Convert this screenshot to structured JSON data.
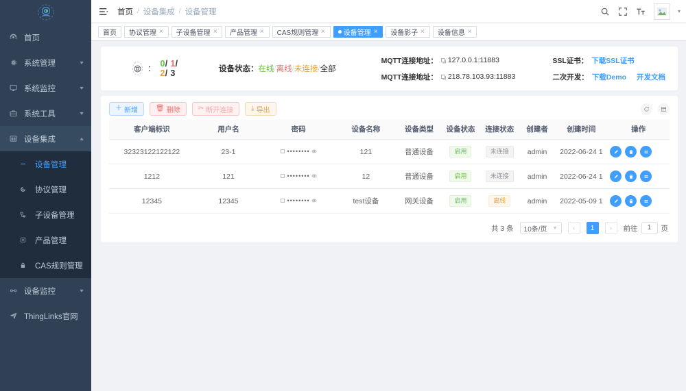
{
  "sidebar": {
    "logo_icon": "fingerprint-logo-icon",
    "items": [
      {
        "label": "首页",
        "icon": "dashboard-icon",
        "expandable": false
      },
      {
        "label": "系统管理",
        "icon": "gear-icon",
        "expandable": true,
        "arrow": "▾"
      },
      {
        "label": "系统监控",
        "icon": "monitor-icon",
        "expandable": true,
        "arrow": "▾"
      },
      {
        "label": "系统工具",
        "icon": "toolbox-icon",
        "expandable": true,
        "arrow": "▾"
      },
      {
        "label": "设备集成",
        "icon": "device-icon",
        "expandable": true,
        "arrow": "▴",
        "open": true
      },
      {
        "label": "设备监控",
        "icon": "device-monitor-icon",
        "expandable": true,
        "arrow": "▾"
      },
      {
        "label": "ThingLinks官网",
        "icon": "send-icon",
        "expandable": false
      }
    ],
    "submenu": [
      {
        "label": "设备管理",
        "icon": "minus-icon",
        "active": true
      },
      {
        "label": "协议管理",
        "icon": "protocol-icon",
        "active": false
      },
      {
        "label": "子设备管理",
        "icon": "subdevice-icon",
        "active": false
      },
      {
        "label": "产品管理",
        "icon": "product-icon",
        "active": false
      },
      {
        "label": "CAS规则管理",
        "icon": "lock-icon",
        "active": false
      }
    ]
  },
  "topbar": {
    "hamburger_icon": "hamburger-menu-icon",
    "breadcrumb": [
      "首页",
      "设备集成",
      "设备管理"
    ],
    "separator": "/",
    "icons": [
      "search-icon",
      "fullscreen-icon",
      "font-size-icon"
    ],
    "avatar_icon": "avatar-image-icon",
    "caret": "▾"
  },
  "tabs": [
    {
      "label": "首页",
      "closable": false,
      "active": false
    },
    {
      "label": "协议管理",
      "closable": true,
      "active": false
    },
    {
      "label": "子设备管理",
      "closable": true,
      "active": false
    },
    {
      "label": "产品管理",
      "closable": true,
      "active": false
    },
    {
      "label": "CAS规则管理",
      "closable": true,
      "active": false
    },
    {
      "label": "设备管理",
      "closable": true,
      "active": true
    },
    {
      "label": "设备影子",
      "closable": true,
      "active": false
    },
    {
      "label": "设备信息",
      "closable": true,
      "active": false
    }
  ],
  "info_card": {
    "counts_icon": "lifebuoy-icon",
    "colon": "：",
    "counts": {
      "online": "0",
      "offline": "1",
      "unconnected": "2",
      "total": "3",
      "slash": "/"
    },
    "status_filter_label": "设备状态：",
    "status_filter_options": [
      "在线",
      "离线",
      "未连接",
      "全部"
    ],
    "status_filter_sep": "/",
    "mqtt": [
      {
        "label": "MQTT连接地址：",
        "value": "127.0.0.1:11883",
        "copy_icon": "copy-icon"
      },
      {
        "label": "MQTT连接地址：",
        "value": "218.78.103.93:11883",
        "copy_icon": "copy-icon"
      }
    ],
    "ssl": [
      {
        "label": "SSL证书：",
        "links": [
          "下载SSL证书"
        ]
      },
      {
        "label": "二次开发：",
        "links": [
          "下载Demo",
          "开发文档"
        ]
      }
    ]
  },
  "toolbar": {
    "buttons": [
      {
        "label": "新增",
        "icon": "plus-icon",
        "glyph": "＋",
        "style": "primary"
      },
      {
        "label": "删除",
        "icon": "trash-icon",
        "glyph": "🗑",
        "style": "danger"
      },
      {
        "label": "断开连接",
        "icon": "disconnect-icon",
        "glyph": "✂",
        "style": "danger2"
      },
      {
        "label": "导出",
        "icon": "download-icon",
        "glyph": "⤓",
        "style": "warning"
      }
    ],
    "right_icons": [
      {
        "icon": "refresh-icon",
        "glyph": "⟳"
      },
      {
        "icon": "column-settings-icon",
        "glyph": "▤"
      }
    ]
  },
  "table": {
    "headers": [
      "客户端标识",
      "用户名",
      "密码",
      "设备名称",
      "设备类型",
      "设备状态",
      "连接状态",
      "创建者",
      "创建时间",
      "操作"
    ],
    "rows": [
      {
        "client_id": "32323122122122",
        "username": "23-1",
        "password": "••••••••",
        "password_icon": "eye-icon",
        "password_lock_icon": "field-icon",
        "device_name": "121",
        "device_type": "普通设备",
        "device_status": "启用",
        "device_status_style": "green",
        "conn_status": "未连接",
        "conn_status_style": "gray",
        "creator": "admin",
        "create_time": "2022-06-24 1",
        "ops": [
          {
            "icon": "edit-icon",
            "glyph": "✎"
          },
          {
            "icon": "delete-icon",
            "glyph": "🗑"
          },
          {
            "icon": "more-icon",
            "glyph": "☰"
          }
        ]
      },
      {
        "client_id": "1212",
        "username": "121",
        "password": "••••••••",
        "password_icon": "eye-icon",
        "password_lock_icon": "field-icon",
        "device_name": "12",
        "device_type": "普通设备",
        "device_status": "启用",
        "device_status_style": "green",
        "conn_status": "未连接",
        "conn_status_style": "gray",
        "creator": "admin",
        "create_time": "2022-06-24 1",
        "ops": [
          {
            "icon": "edit-icon",
            "glyph": "✎"
          },
          {
            "icon": "delete-icon",
            "glyph": "🗑"
          },
          {
            "icon": "more-icon",
            "glyph": "☰"
          }
        ]
      },
      {
        "client_id": "12345",
        "username": "12345",
        "password": "••••••••",
        "password_icon": "eye-icon",
        "password_lock_icon": "field-icon",
        "device_name": "test设备",
        "device_type": "网关设备",
        "device_status": "启用",
        "device_status_style": "green",
        "conn_status": "离线",
        "conn_status_style": "orange",
        "creator": "admin",
        "create_time": "2022-05-09 1",
        "ops": [
          {
            "icon": "edit-icon",
            "glyph": "✎"
          },
          {
            "icon": "delete-icon",
            "glyph": "🗑"
          },
          {
            "icon": "more-icon",
            "glyph": "☰"
          }
        ]
      }
    ]
  },
  "pagination": {
    "total_text": "共 3 条",
    "page_size": "10条/页",
    "prev": "‹",
    "next": "›",
    "current_page": "1",
    "jump_label": "前往",
    "jump_value": "1",
    "jump_suffix": "页"
  },
  "colors": {
    "sidebar_bg": "#304156",
    "submenu_bg": "#1f2d3d",
    "accent": "#409eff",
    "success": "#67c23a",
    "danger": "#f56c6c",
    "warning": "#e6a23c",
    "page_bg": "#f0f2f5"
  }
}
